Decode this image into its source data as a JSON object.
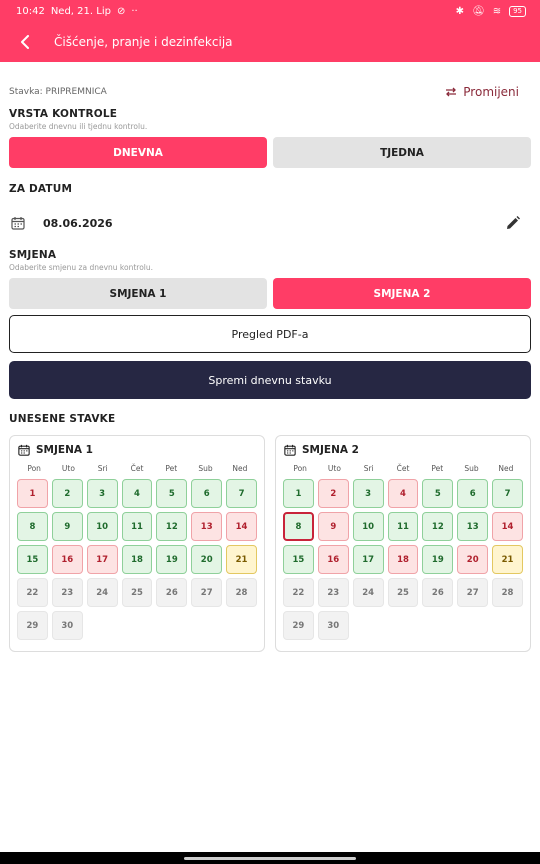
{
  "status": {
    "time": "10:42",
    "date": "Ned, 21. Lip",
    "battery": "95"
  },
  "appbar": {
    "title": "Čišćenje, pranje i dezinfekcija"
  },
  "stavka": {
    "label": "Stavka: PRIPREMNICA",
    "change_label": "Promijeni"
  },
  "vrsta": {
    "title": "VRSTA KONTROLE",
    "subtitle": "Odaberite dnevnu ili tjednu kontrolu.",
    "options": [
      "DNEVNA",
      "TJEDNA"
    ],
    "selected": "DNEVNA"
  },
  "datum": {
    "title": "ZA DATUM",
    "value": "08.06.2026"
  },
  "smjena": {
    "title": "SMJENA",
    "subtitle": "Odaberite smjenu za dnevnu kontrolu.",
    "options": [
      "SMJENA 1",
      "SMJENA 2"
    ],
    "selected": "SMJENA 2"
  },
  "buttons": {
    "pdf": "Pregled PDF-a",
    "save": "Spremi dnevnu stavku"
  },
  "unesene": {
    "title": "UNESENE STAVKE",
    "weekdays": [
      "Pon",
      "Uto",
      "Sri",
      "Čet",
      "Pet",
      "Sub",
      "Ned"
    ],
    "calendars": [
      {
        "title": "SMJENA 1",
        "days": [
          {
            "d": "1",
            "s": "red"
          },
          {
            "d": "2",
            "s": "green"
          },
          {
            "d": "3",
            "s": "green"
          },
          {
            "d": "4",
            "s": "green"
          },
          {
            "d": "5",
            "s": "green"
          },
          {
            "d": "6",
            "s": "green"
          },
          {
            "d": "7",
            "s": "green"
          },
          {
            "d": "8",
            "s": "green"
          },
          {
            "d": "9",
            "s": "green"
          },
          {
            "d": "10",
            "s": "green"
          },
          {
            "d": "11",
            "s": "green"
          },
          {
            "d": "12",
            "s": "green"
          },
          {
            "d": "13",
            "s": "red"
          },
          {
            "d": "14",
            "s": "red"
          },
          {
            "d": "15",
            "s": "green"
          },
          {
            "d": "16",
            "s": "red"
          },
          {
            "d": "17",
            "s": "red"
          },
          {
            "d": "18",
            "s": "green"
          },
          {
            "d": "19",
            "s": "green"
          },
          {
            "d": "20",
            "s": "green"
          },
          {
            "d": "21",
            "s": "yellow"
          },
          {
            "d": "22",
            "s": "grey"
          },
          {
            "d": "23",
            "s": "grey"
          },
          {
            "d": "24",
            "s": "grey"
          },
          {
            "d": "25",
            "s": "grey"
          },
          {
            "d": "26",
            "s": "grey"
          },
          {
            "d": "27",
            "s": "grey"
          },
          {
            "d": "28",
            "s": "grey"
          },
          {
            "d": "29",
            "s": "grey"
          },
          {
            "d": "30",
            "s": "grey"
          }
        ]
      },
      {
        "title": "SMJENA 2",
        "days": [
          {
            "d": "1",
            "s": "green"
          },
          {
            "d": "2",
            "s": "red"
          },
          {
            "d": "3",
            "s": "green"
          },
          {
            "d": "4",
            "s": "red"
          },
          {
            "d": "5",
            "s": "green"
          },
          {
            "d": "6",
            "s": "green"
          },
          {
            "d": "7",
            "s": "green"
          },
          {
            "d": "8",
            "s": "selected"
          },
          {
            "d": "9",
            "s": "red"
          },
          {
            "d": "10",
            "s": "green"
          },
          {
            "d": "11",
            "s": "green"
          },
          {
            "d": "12",
            "s": "green"
          },
          {
            "d": "13",
            "s": "green"
          },
          {
            "d": "14",
            "s": "red"
          },
          {
            "d": "15",
            "s": "green"
          },
          {
            "d": "16",
            "s": "red"
          },
          {
            "d": "17",
            "s": "green"
          },
          {
            "d": "18",
            "s": "red"
          },
          {
            "d": "19",
            "s": "green"
          },
          {
            "d": "20",
            "s": "red"
          },
          {
            "d": "21",
            "s": "yellow"
          },
          {
            "d": "22",
            "s": "grey"
          },
          {
            "d": "23",
            "s": "grey"
          },
          {
            "d": "24",
            "s": "grey"
          },
          {
            "d": "25",
            "s": "grey"
          },
          {
            "d": "26",
            "s": "grey"
          },
          {
            "d": "27",
            "s": "grey"
          },
          {
            "d": "28",
            "s": "grey"
          },
          {
            "d": "29",
            "s": "grey"
          },
          {
            "d": "30",
            "s": "grey"
          }
        ]
      }
    ]
  },
  "colors": {
    "accent": "#ff3d66",
    "dark": "#262743"
  },
  "icons": [
    "back-arrow-icon",
    "swap-icon",
    "calendar-icon",
    "edit-pencil-icon"
  ]
}
